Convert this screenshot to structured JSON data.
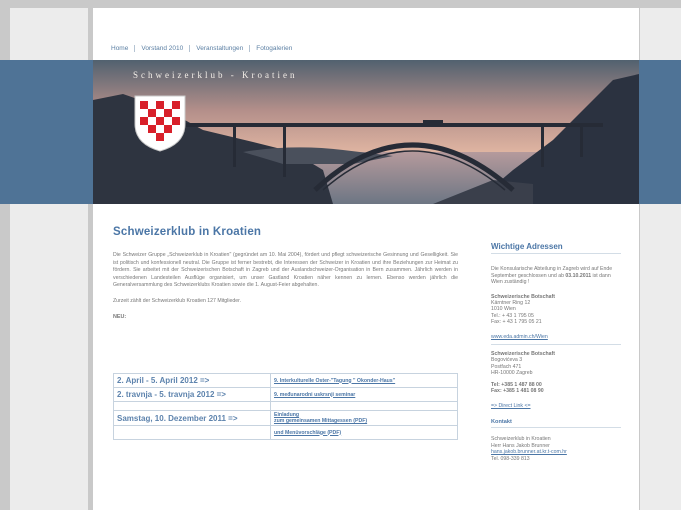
{
  "nav": [
    "Home",
    "Vorstand 2010",
    "Veranstaltungen",
    "Fotogalerien"
  ],
  "banner": {
    "title": "Schweizerklub - Kroatien"
  },
  "main": {
    "title": "Schweizerklub in Kroatien",
    "intro": "Die Schweizer Gruppe „Schweizerklub in Kroatien\" (gegründet am 10. Mai 2004), fördert und pflegt schweizerische Gesinnung und Geselligkeit. Sie ist politisch und konfessionell neutral. Die Gruppe ist ferner bestrebt, die Interessen der Schweizer in Kroatien und ihre Beziehungen zur Heimat zu fördern. Sie arbeitet mit der Schweizerischen Botschaft in Zagreb und der Auslandschweizer-Organisation in Bern zusammen. Jährlich werden in verschiedenen Landesteilen Ausflüge organisiert, um unser Gastland Kroatien näher kennen zu lernen. Ebenso werden jährlich die Generalversammlung des Schweizerklubs Kroatien sowie die 1. August-Feier abgehalten.",
    "members": "Zurzeit zählt der Schweizerklub Kroatien 127 Mitglieder.",
    "neu": "NEU:"
  },
  "events": [
    {
      "date": "2. April - 5. April 2012 =>",
      "links": [
        "9. Interkulturelle Oster-\"Tagung \" Okonder-Haus\""
      ]
    },
    {
      "date": "2. travnja - 5. travnja 2012 =>",
      "links": [
        "9. međunarodni uskrsnji seminar"
      ]
    },
    {
      "date": "Samstag, 10. Dezember 2011 =>",
      "links": [
        "Einladung",
        "zum gemeinsamen Mittagessen (PDF)"
      ]
    },
    {
      "date": "",
      "links": [
        "und Menüvorschläge (PDF)"
      ]
    }
  ],
  "sidebar": {
    "heading": "Wichtige Adressen",
    "notice_pre": "Die Konsularische Abteilung in Zagreb wird auf Ende September geschlossen und ab ",
    "notice_date": "03.10.2011",
    "notice_post": " ist dann Wien zuständig !",
    "embassy_wien": {
      "name": "Schweizerische Botschaft",
      "lines": [
        "Kärntner Ring 12",
        "1010 Wien",
        "Tel.: + 43 1 795 05",
        "Fax: + 43 1 795 05 21"
      ],
      "link": "www.eda.admin.ch/Wien"
    },
    "embassy_zagreb": {
      "name": "Schweizerische Botschaft",
      "lines": [
        "Bogovićeva 3",
        "Postfach 471",
        "HR-10000 Zagreb"
      ],
      "tel": "Tel: +385 1 487 88 00",
      "fax": "Fax: +385 1 481 08 90"
    },
    "direct_link": "=> Direct Link <=",
    "contact_heading": "Kontakt",
    "contact_lines": [
      "Schweizerklub in Kroatien",
      "Herr Hans Jakob Brunner"
    ],
    "contact_email": "hans.jakob.brunner.at.kr.t-com.hr",
    "contact_tel": "Tel. 098-339 813"
  },
  "colors": {
    "accent": "#4b76a6",
    "band": "#4f7396",
    "sky": "#e3b7a3"
  }
}
